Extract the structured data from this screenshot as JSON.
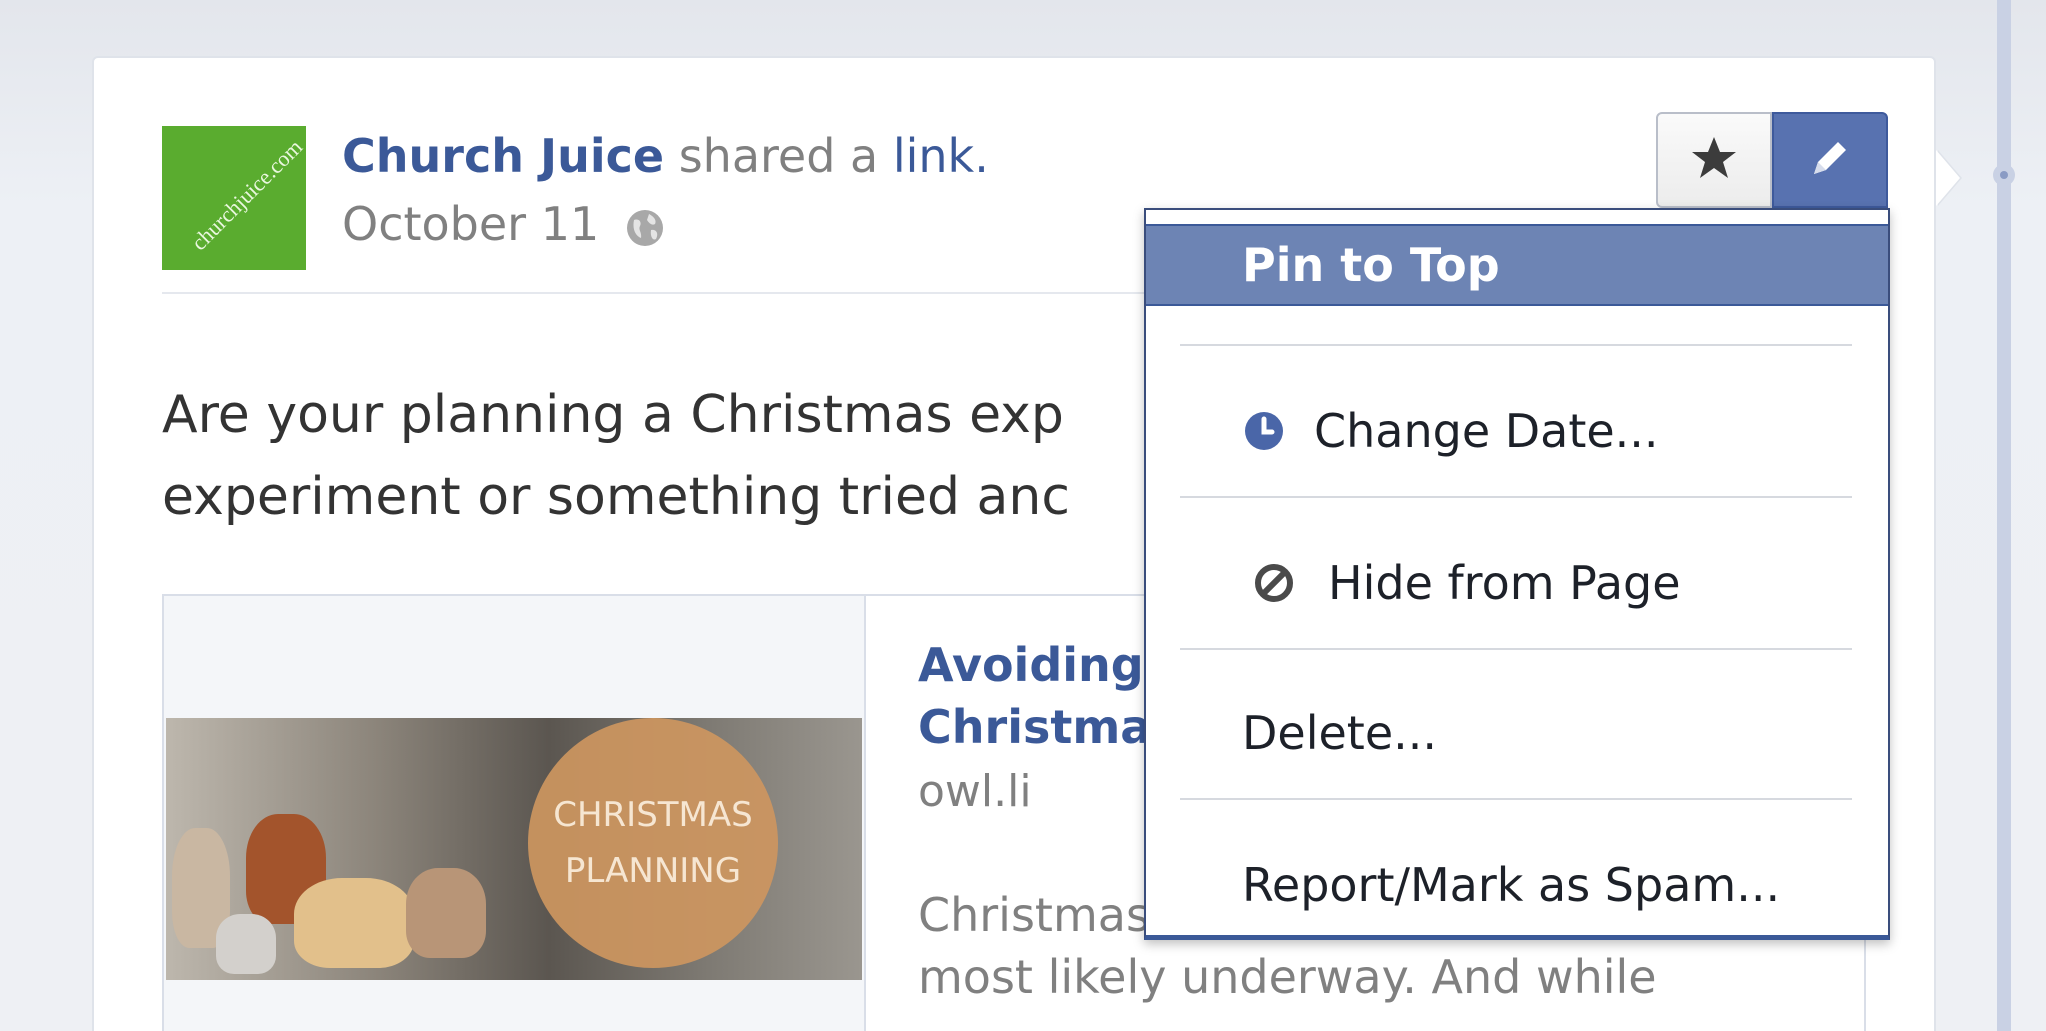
{
  "post": {
    "author": "Church Juice",
    "action_prefix": " shared a ",
    "action_link": "link.",
    "date": "October 11",
    "avatar_text": "churchjuice.com",
    "text_line1": "Are your planning a Christmas exp",
    "text_line2": "experiment or something tried anc"
  },
  "link": {
    "title_line1": "Avoiding",
    "title_line2": "Christma",
    "domain": "owl.li",
    "summary_line1": "Christmas",
    "summary_line2": "most likely underway. And while",
    "image_badge_line1": "CHRISTMAS",
    "image_badge_line2": "PLANNING"
  },
  "toolbar": {
    "star_icon": "star-icon",
    "edit_icon": "pencil-icon"
  },
  "menu": {
    "items": [
      {
        "label": "Pin to Top",
        "icon": ""
      },
      {
        "label": "Change Date...",
        "icon": "clock-icon"
      },
      {
        "label": "Hide from Page",
        "icon": "hide-icon"
      },
      {
        "label": "Delete...",
        "icon": ""
      },
      {
        "label": "Report/Mark as Spam...",
        "icon": ""
      }
    ]
  },
  "colors": {
    "brand": "#3b5998",
    "menu_highlight": "#6d84b4",
    "avatar_green": "#5aac2f"
  }
}
